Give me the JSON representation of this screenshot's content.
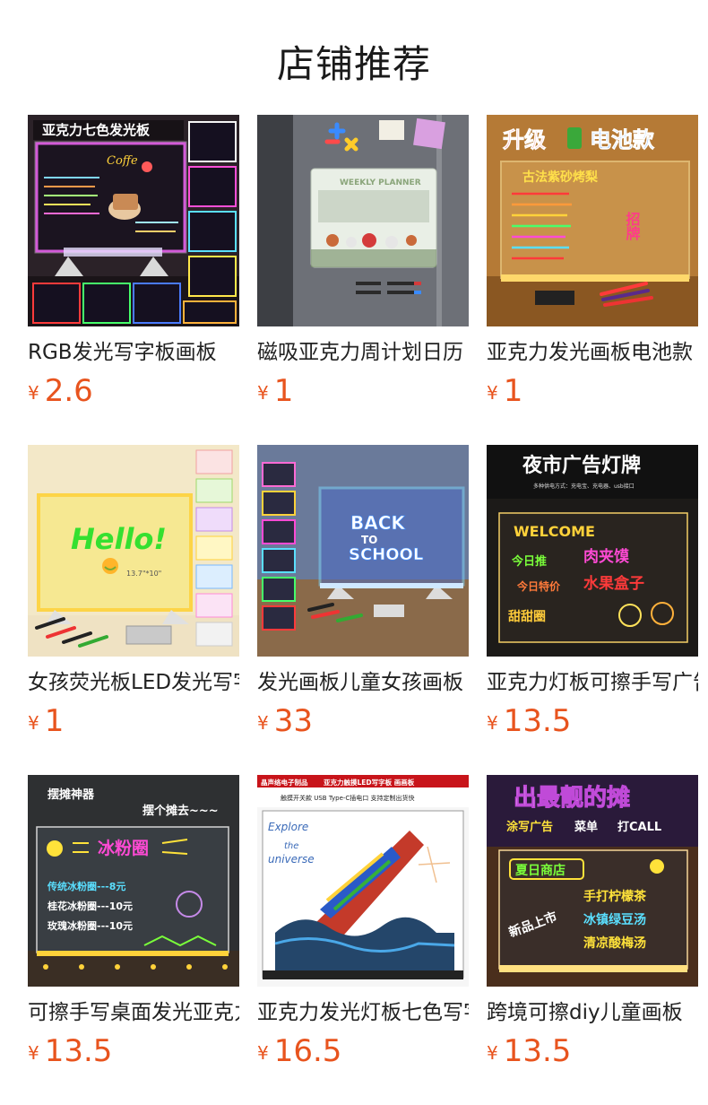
{
  "section_title": "店铺推荐",
  "currency_symbol": "¥",
  "products": [
    {
      "name": "RGB发光写字板画板",
      "price": "2.6",
      "image_text": [
        "亚克力七色发光板",
        "Coffe"
      ]
    },
    {
      "name": "磁吸亚克力周计划日历",
      "price": "1",
      "image_text": [
        "WEEKLY PLANNER"
      ]
    },
    {
      "name": "亚克力发光画板电池款",
      "price": "1",
      "image_text": [
        "升级",
        "电池款",
        "古法紫砂烤梨",
        "招牌"
      ]
    },
    {
      "name": "女孩荧光板LED发光写字板",
      "price": "1",
      "image_text": [
        "Hello!",
        "13.7\"*10\""
      ]
    },
    {
      "name": "发光画板儿童女孩画板",
      "price": "33",
      "image_text": [
        "BACK",
        "TO",
        "SCHOOL"
      ]
    },
    {
      "name": "亚克力灯板可擦手写广告牌",
      "price": "13.5",
      "image_text": [
        "夜市广告灯牌",
        "多种供电方式：充电宝、充电器、usb接口",
        "WELCOME",
        "今日推",
        "肉夹馍",
        "今日特价",
        "水果盒子",
        "甜甜圈"
      ]
    },
    {
      "name": "可擦手写桌面发光亚克力板",
      "price": "13.5",
      "image_text": [
        "摆摊神器",
        "摆个摊去~~~",
        "冰粉圈",
        "传统冰粉圈---8元",
        "桂花冰粉圈---10元",
        "玫瑰冰粉圈---10元"
      ]
    },
    {
      "name": "亚克力发光灯板七色写字板",
      "price": "16.5",
      "image_text": [
        "晶声络电子制品",
        "亚克力触摸LED写字板 画画板",
        "触摸开关款 USB Type-C插电口 支持定制出货快",
        "Explore",
        "the",
        "universe"
      ]
    },
    {
      "name": "跨境可擦diy儿童画板",
      "price": "13.5",
      "image_text": [
        "出最靓的摊",
        "涂写广告",
        "菜单",
        "打CALL",
        "夏日商店",
        "手打柠檬茶",
        "新品上市",
        "冰镇绿豆汤",
        "清凉酸梅汤"
      ]
    }
  ]
}
